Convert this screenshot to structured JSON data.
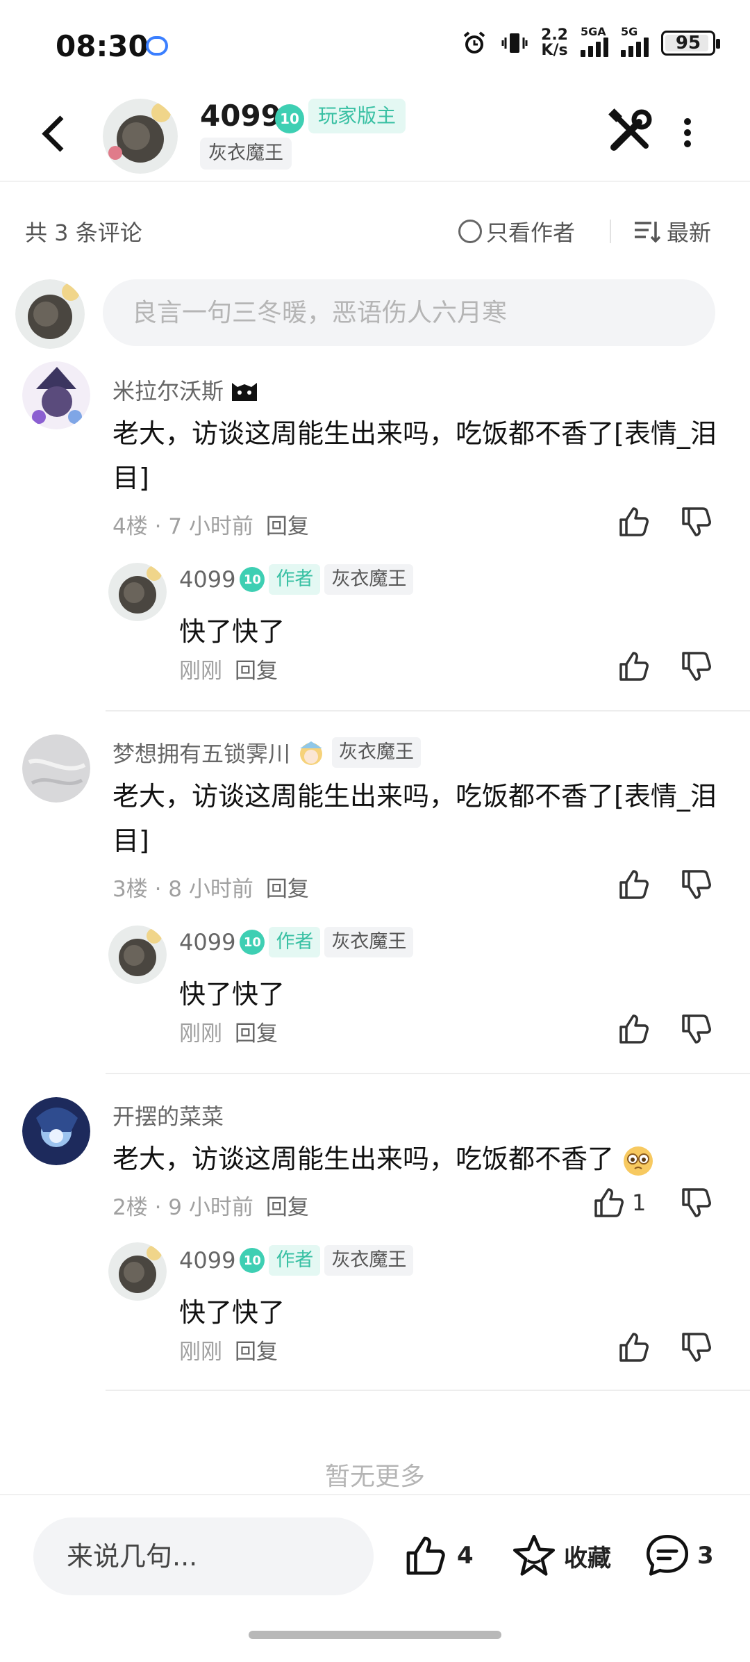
{
  "status": {
    "time": "08:30",
    "speed_top": "2.2",
    "speed_bottom": "K/s",
    "net1": "5GA",
    "net2": "5G",
    "battery": "95"
  },
  "header": {
    "name": "4099",
    "level": "10",
    "role": "玩家版主",
    "tag": "灰衣魔王"
  },
  "summary": {
    "count": "共 3 条评论",
    "author_only": "只看作者",
    "latest": "最新"
  },
  "input": {
    "placeholder": "良言一句三冬暖，恶语伤人六月寒"
  },
  "comments": [
    {
      "user": "米拉尔沃斯",
      "tag": "",
      "text": "老大，访谈这周能生出来吗，吃饭都不香了[表情_泪目]",
      "floor": "4楼 · 7 小时前",
      "reply_label": "回复",
      "likes": "",
      "reply": {
        "user": "4099",
        "level": "10",
        "author": "作者",
        "tag": "灰衣魔王",
        "text": "快了快了",
        "time": "刚刚",
        "reply_label": "回复"
      }
    },
    {
      "user": "梦想拥有五锁霁川",
      "tag": "灰衣魔王",
      "text": "老大，访谈这周能生出来吗，吃饭都不香了[表情_泪目]",
      "floor": "3楼 · 8 小时前",
      "reply_label": "回复",
      "likes": "",
      "reply": {
        "user": "4099",
        "level": "10",
        "author": "作者",
        "tag": "灰衣魔王",
        "text": "快了快了",
        "time": "刚刚",
        "reply_label": "回复"
      }
    },
    {
      "user": "开摆的菜菜",
      "tag": "",
      "text": "老大，访谈这周能生出来吗，吃饭都不香了",
      "floor": "2楼 · 9 小时前",
      "reply_label": "回复",
      "likes": "1",
      "reply": {
        "user": "4099",
        "level": "10",
        "author": "作者",
        "tag": "灰衣魔王",
        "text": "快了快了",
        "time": "刚刚",
        "reply_label": "回复"
      }
    }
  ],
  "no_more": "暂无更多",
  "bottom": {
    "placeholder": "来说几句...",
    "likes": "4",
    "favorite": "收藏",
    "comments": "3"
  },
  "colors": {
    "accent": "#3ecfb3",
    "accent_bg": "#e4f8f3",
    "tag_bg": "#f2f3f5"
  }
}
